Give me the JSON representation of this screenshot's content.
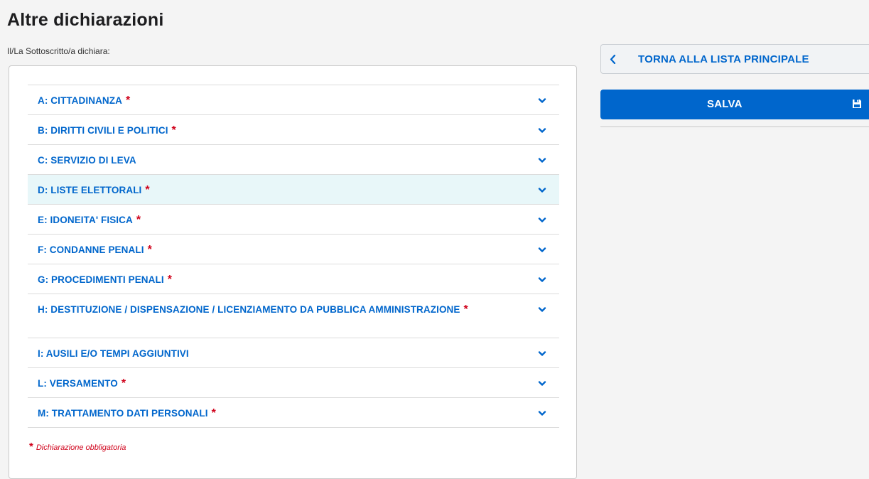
{
  "page": {
    "title": "Altre dichiarazioni",
    "subtitle": "Il/La Sottoscritto/a dichiara:"
  },
  "accordion": {
    "items": [
      {
        "label": "A: CITTADINANZA",
        "required": true
      },
      {
        "label": "B: DIRITTI CIVILI E POLITICI",
        "required": true
      },
      {
        "label": "C: SERVIZIO DI LEVA",
        "required": false
      },
      {
        "label": "D: LISTE ELETTORALI",
        "required": true,
        "highlighted": true
      },
      {
        "label": "E: IDONEITA' FISICA",
        "required": true
      },
      {
        "label": "F: CONDANNE PENALI",
        "required": true
      },
      {
        "label": "G: PROCEDIMENTI PENALI",
        "required": true
      },
      {
        "label": "H: DESTITUZIONE / DISPENSAZIONE / LICENZIAMENTO DA PUBBLICA AMMINISTRAZIONE",
        "required": true
      },
      {
        "label": "I: AUSILI E/O TEMPI AGGIUNTIVI",
        "required": false
      },
      {
        "label": "L: VERSAMENTO",
        "required": true
      },
      {
        "label": "M: TRATTAMENTO DATI PERSONALI",
        "required": true
      }
    ],
    "required_marker": "*",
    "item_icon": "chevron-down-icon"
  },
  "legend": {
    "marker": "*",
    "text": "Dichiarazione obbligatoria"
  },
  "sidebar": {
    "back_label": "TORNA ALLA LISTA PRINCIPALE",
    "back_icon": "chevron-left-icon",
    "save_label": "SALVA",
    "save_icon": "floppy-disk-icon"
  },
  "colors": {
    "accent": "#0066cc",
    "required": "#d0021b",
    "highlight_row": "#e8f7f9",
    "background": "#f4f4f4"
  }
}
